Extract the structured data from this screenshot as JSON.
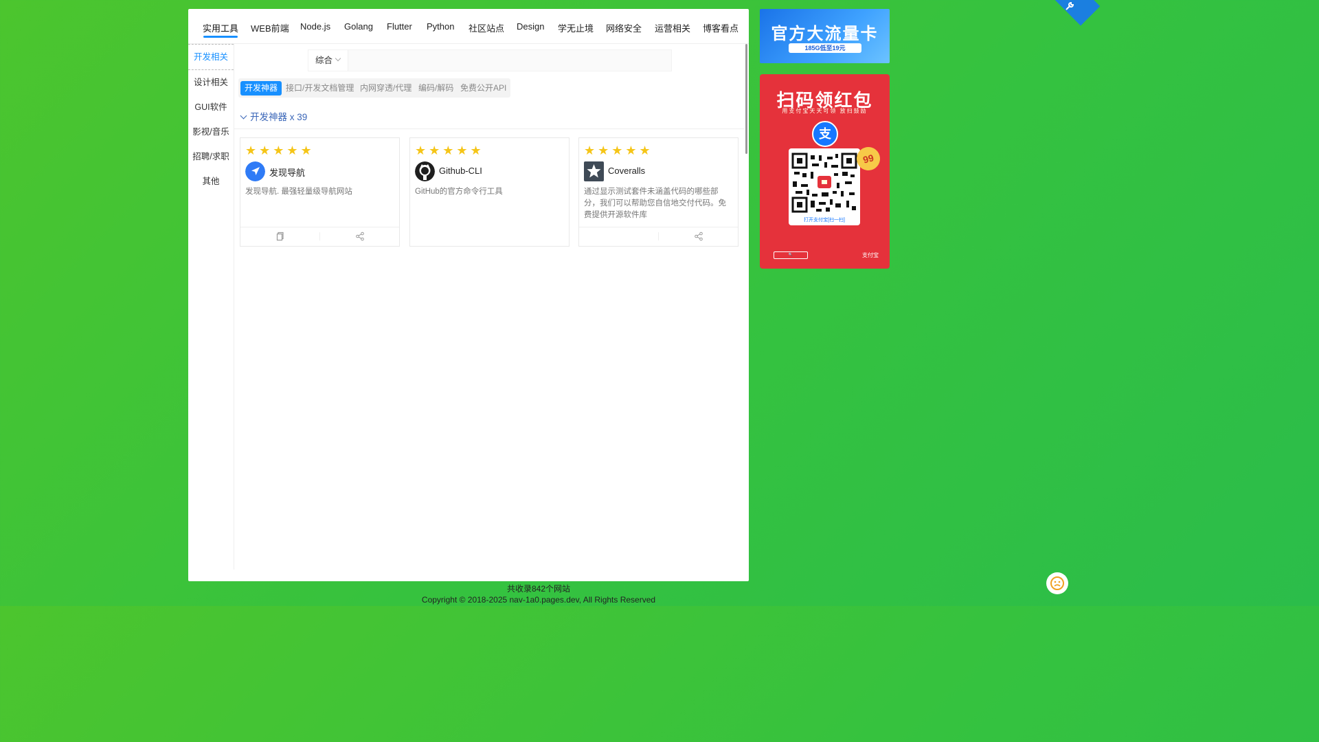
{
  "top_nav": {
    "tabs": [
      "实用工具",
      "WEB前端",
      "Node.js",
      "Golang",
      "Flutter",
      "Python",
      "社区站点",
      "Design",
      "学无止境",
      "网络安全",
      "运营相关",
      "博客看点"
    ],
    "active": 0
  },
  "sidebar": {
    "items": [
      "开发相关",
      "设计相关",
      "GUI软件",
      "影视/音乐",
      "招聘/求职",
      "其他"
    ],
    "active": 0
  },
  "search": {
    "select_value": "综合",
    "value": ""
  },
  "subtabs": {
    "items": [
      "开发神器",
      "接口/开发文档管理",
      "内网穿透/代理",
      "编码/解码",
      "免费公开API"
    ],
    "active": 0
  },
  "group": {
    "title": "开发神器 x 39"
  },
  "cards": [
    {
      "title": "发现导航",
      "desc": "发现导航. 最强轻量级导航网站",
      "rating": 5,
      "icon": "navigation-arrow-icon",
      "icon_color": "#2f7bf6"
    },
    {
      "title": "Github-CLI",
      "desc": "GitHub的官方命令行工具",
      "rating": 5,
      "icon": "github-icon",
      "icon_color": "#1f1f1f"
    },
    {
      "title": "Coveralls",
      "desc": "通过显示测试套件未涵盖代码的哪些部分，我们可以帮助您自信地交付代码。免费提供开源软件库",
      "rating": 5,
      "icon": "coveralls-star-icon",
      "icon_color": "#3f4a56"
    }
  ],
  "ads": {
    "ad1_title": "官方大流量卡",
    "ad1_sub": "185G低至19元",
    "ad2_title": "扫码领红包",
    "ad2_sub": "用支付宝天天可领 放扫鼓励",
    "ad2_qr_caption": "打开支付宝[扫一扫]",
    "ad2_badge": "99",
    "ad2_brand": "支付宝"
  },
  "footer": {
    "count": "共收录842个网站",
    "copyright": "Copyright © 2018-2025 nav-1a0.pages.dev, All Rights Reserved"
  },
  "colors": {
    "accent": "#1890ff",
    "background": "#3cc23a",
    "star": "#f5c518"
  }
}
